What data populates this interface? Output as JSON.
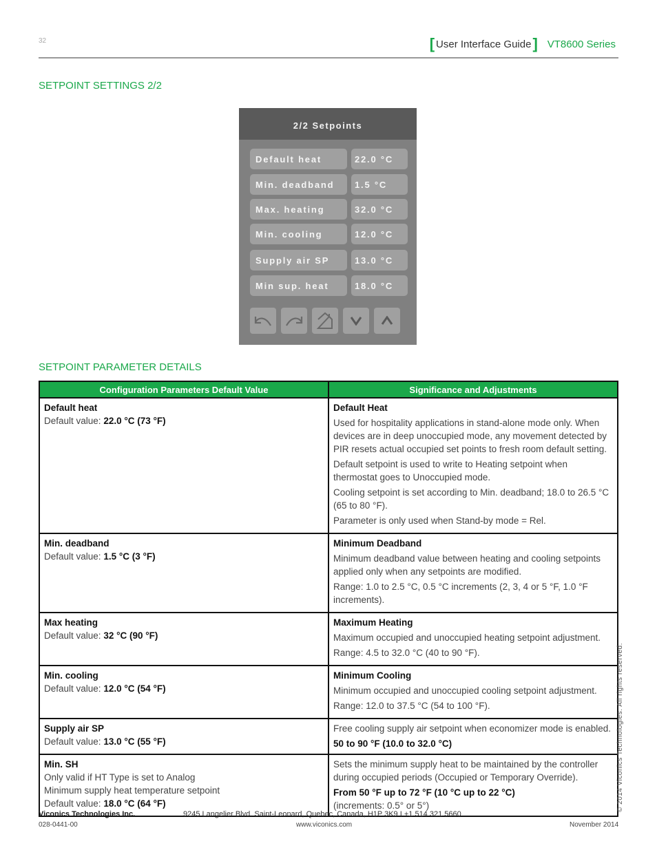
{
  "header": {
    "page_number": "32",
    "guide_title": "User Interface Guide",
    "series": "VT8600 Series",
    "accent_color": "#1aa84a"
  },
  "section1_title": "SETPOINT SETTINGS 2/2",
  "device": {
    "title": "2/2 Setpoints",
    "rows": [
      {
        "label": "Default heat",
        "value": "22.0 °C"
      },
      {
        "label": "Min. deadband",
        "value": "1.5 °C"
      },
      {
        "label": "Max. heating",
        "value": "32.0 °C"
      },
      {
        "label": "Min. cooling",
        "value": "12.0 °C"
      },
      {
        "label": "Supply air SP",
        "value": "13.0 °C"
      },
      {
        "label": "Min sup. heat",
        "value": "18.0 °C"
      }
    ],
    "buttons": [
      "back-icon",
      "forward-icon",
      "home-icon",
      "chevron-down-icon",
      "chevron-up-icon"
    ]
  },
  "section2_title": "SETPOINT PARAMETER DETAILS",
  "table": {
    "headers": [
      "Configuration Parameters Default Value",
      "Significance and Adjustments"
    ],
    "rows": [
      {
        "name": "Default heat",
        "notes": [],
        "default_prefix": "Default value: ",
        "default_value": "22.0 °C (73 °F)",
        "title": "Default Heat",
        "paragraphs": [
          "Used for hospitality applications in stand-alone mode only. When devices are in deep unoccupied mode, any movement detected by PIR resets actual occupied set points to fresh room default setting.",
          "Default setpoint is used to write to Heating setpoint when thermostat goes to Unoccupied mode.",
          "Cooling setpoint is set according to Min. deadband; 18.0 to 26.5 °C (65 to 80 °F).",
          "Parameter is only used when Stand-by mode = Rel."
        ],
        "bold_line": "",
        "tail": ""
      },
      {
        "name": "Min. deadband",
        "notes": [],
        "default_prefix": "Default value: ",
        "default_value": "1.5 °C (3 °F)",
        "title": "Minimum Deadband",
        "paragraphs": [
          "Minimum deadband value between heating and cooling setpoints applied only when any setpoints are modified.",
          "Range: 1.0 to 2.5 °C, 0.5 °C increments (2, 3, 4 or 5 °F, 1.0 °F increments)."
        ],
        "bold_line": "",
        "tail": ""
      },
      {
        "name": "Max heating",
        "notes": [],
        "default_prefix": "Default value: ",
        "default_value": "32 °C (90 °F)",
        "title": "Maximum Heating",
        "paragraphs": [
          "Maximum occupied and unoccupied heating setpoint adjustment.",
          "Range: 4.5 to 32.0 °C (40 to 90 °F)."
        ],
        "bold_line": "",
        "tail": ""
      },
      {
        "name": "Min. cooling",
        "notes": [],
        "default_prefix": "Default value: ",
        "default_value": "12.0 °C (54 °F)",
        "title": "Minimum Cooling",
        "paragraphs": [
          "Minimum occupied and  unoccupied cooling setpoint adjustment.",
          "Range: 12.0 to 37.5 °C (54 to 100 °F)."
        ],
        "bold_line": "",
        "tail": ""
      },
      {
        "name": "Supply air SP",
        "notes": [],
        "default_prefix": "Default value: ",
        "default_value": "13.0 °C (55 °F)",
        "title": "",
        "paragraphs": [
          "Free cooling supply air setpoint when economizer mode is enabled."
        ],
        "bold_line": "50 to 90 °F (10.0 to 32.0 °C)",
        "tail": ""
      },
      {
        "name": "Min. SH",
        "notes": [
          "Only valid if HT Type is set to Analog",
          "Minimum supply heat temperature setpoint"
        ],
        "default_prefix": "Default value: ",
        "default_value": "18.0 °C (64 °F)",
        "title": "",
        "paragraphs": [
          "Sets the minimum supply heat to be maintained by the controller during occupied periods (Occupied or Temporary Override)."
        ],
        "bold_line": "From 50 °F up to 72 °F (10 °C up to 22 °C)",
        "tail": "(increments: 0.5° or 5°)"
      }
    ]
  },
  "side_copyright": "© 2014 Viconics Technologies. All rights reserved.",
  "footer": {
    "company": "Viconics Technologies Inc.",
    "address": "9245 Langelier Blvd. Saint-Leonard, Quebec, Canada, H1P 3K9   I  +1 514 321 5660",
    "doc_number": "028-0441-00",
    "website": "www.viconics.com",
    "date": "November 2014"
  }
}
